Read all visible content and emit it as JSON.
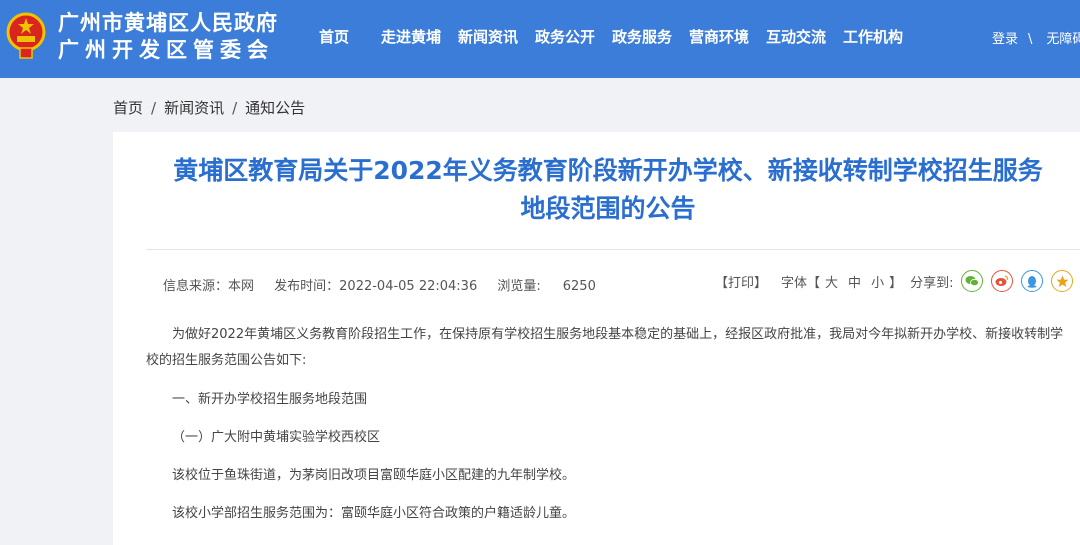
{
  "header": {
    "site_name_line1": "广州市黄埔区人民政府",
    "site_name_line2": "广州开发区管委会",
    "nav": [
      {
        "label": "首页"
      },
      {
        "label": "走进黄埔"
      },
      {
        "label": "新闻资讯"
      },
      {
        "label": "政务公开"
      },
      {
        "label": "政务服务"
      },
      {
        "label": "营商环境"
      },
      {
        "label": "互动交流"
      },
      {
        "label": "工作机构"
      }
    ],
    "login_label": "登录",
    "separator": "\\",
    "accessibility_label": "无障碍",
    "bg_color": "#3b7dd8"
  },
  "breadcrumb": {
    "items": [
      "首页",
      "新闻资讯",
      "通知公告"
    ],
    "separator": "/"
  },
  "article": {
    "title_line1": "黄埔区教育局关于2022年义务教育阶段新开办学校、新接收转制学校招生服务",
    "title_line2": "地段范围的公告",
    "meta": {
      "source": "信息来源：本网",
      "publish_time": "发布时间：2022-04-05 22:04:36",
      "views_label": "浏览量:",
      "views_value": "6250"
    },
    "tools": {
      "print": "【打印】",
      "font_label": "字体【",
      "font_large": "大",
      "font_medium": "中",
      "font_small": "小",
      "font_close": "】",
      "share_label": "分享到:"
    },
    "paragraphs": {
      "p1": "为做好2022年黄埔区义务教育阶段招生工作，在保持原有学校招生服务地段基本稳定的基础上，经报区政府批准，我局对今年拟新开办学校、新接收转制学校的招生服务范围公告如下:",
      "p2": "一、新开办学校招生服务地段范围",
      "p3": "（一）广大附中黄埔实验学校西校区",
      "p4": "该校位于鱼珠街道，为茅岗旧改项目富颐华庭小区配建的九年制学校。",
      "p5": "该校小学部招生服务范围为：富颐华庭小区符合政策的户籍适龄儿童。"
    },
    "title_color": "#2a6fcf"
  },
  "icons": {
    "emblem": "national-emblem-icon",
    "wechat": "wechat-icon",
    "weibo": "weibo-icon",
    "qq": "qq-icon",
    "qzone": "qzone-icon"
  }
}
